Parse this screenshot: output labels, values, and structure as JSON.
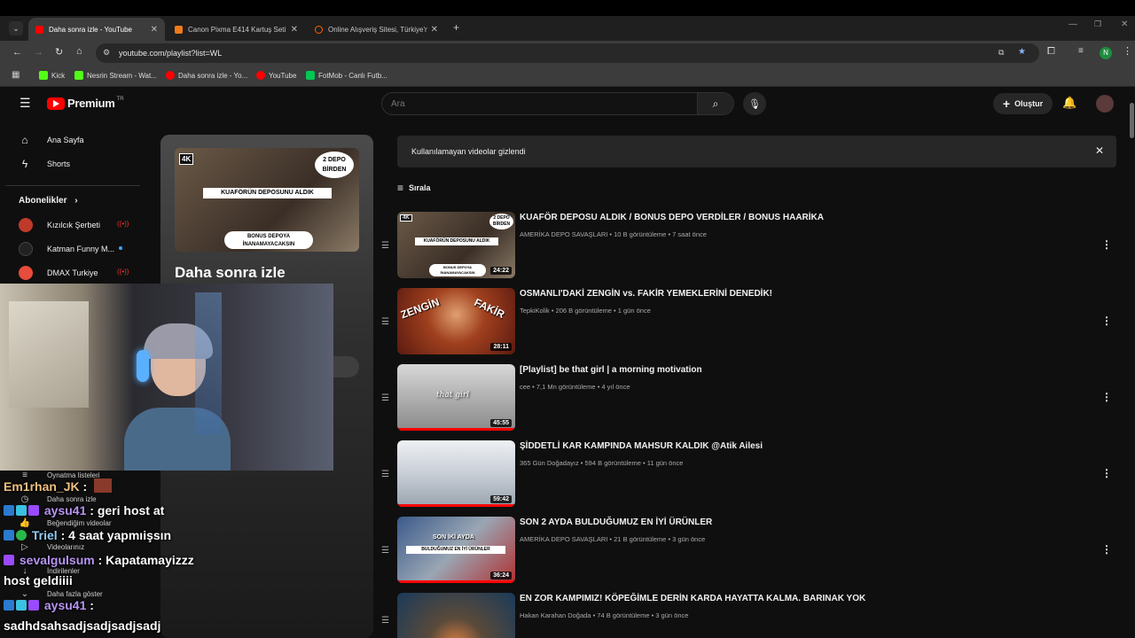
{
  "browser": {
    "tabs": [
      {
        "title": "Daha sonra izle - YouTube",
        "favicon_color": "#ff0000"
      },
      {
        "title": "Canon Pixma E414 Kartuş Seti",
        "favicon_color": "#f27a1a"
      },
      {
        "title": "Online Alışveriş Sitesi, Türkiye'n",
        "favicon_color": "#ff6000"
      }
    ],
    "url": "youtube.com/playlist?list=WL",
    "bookmarks": [
      {
        "label": "Kick",
        "color": "#53fc18"
      },
      {
        "label": "Nesrin Stream - Wat...",
        "color": "#53fc18"
      },
      {
        "label": "Daha sonra izle - Yo...",
        "color": "#ff0000"
      },
      {
        "label": "YouTube",
        "color": "#ff0000"
      },
      {
        "label": "FotMob - Canlı Futb...",
        "color": "#00c853"
      }
    ],
    "profile_initial": "N"
  },
  "youtube": {
    "logo_text": "Premium",
    "region": "TR",
    "search_placeholder": "Ara",
    "create_label": "Oluştur",
    "sidebar": {
      "items": [
        {
          "label": "Ana Sayfa",
          "icon": "home-icon"
        },
        {
          "label": "Shorts",
          "icon": "shorts-icon"
        }
      ],
      "subs_heading": "Abonelikler",
      "subscriptions": [
        {
          "name": "Kızılcık Şerbeti",
          "live": true,
          "color": "#c0392b"
        },
        {
          "name": "Katman Funny M...",
          "live": false,
          "color": "#222222"
        },
        {
          "name": "DMAX Turkiye",
          "live": true,
          "color": "#e74c3c"
        }
      ],
      "you_items": [
        {
          "label": "Oynatma listeleri",
          "icon": "playlist-icon"
        },
        {
          "label": "Daha sonra izle",
          "icon": "clock-icon"
        },
        {
          "label": "Beğendiğim videolar",
          "icon": "like-icon"
        },
        {
          "label": "Videolarınız",
          "icon": "video-icon"
        },
        {
          "label": "İndirilenler",
          "icon": "download-icon"
        },
        {
          "label": "Daha fazla göster",
          "icon": "chevron-down-icon"
        }
      ]
    },
    "playlist": {
      "title": "Daha sonra izle"
    },
    "banner_text": "Kullanılamayan videolar gizlendi",
    "sort_label": "Sırala",
    "videos": [
      {
        "title": "KUAFÖR DEPOSU ALDIK / BONUS DEPO VERDİLER / BONUS HAARİKA",
        "channel": "AMERİKA DEPO SAVAŞLARI",
        "views": "10 B görüntüleme",
        "age": "7 saat önce",
        "duration": "24:22",
        "thumb": "#5a4a3a",
        "progress": 0
      },
      {
        "title": "OSMANLI'DAKİ ZENGİN vs. FAKİR YEMEKLERİNİ DENEDİK!",
        "channel": "TepkiKolik",
        "views": "206 B görüntüleme",
        "age": "1 gün önce",
        "duration": "28:11",
        "thumb": "#8a2a1a",
        "progress": 0
      },
      {
        "title": "[Playlist] be that girl | a morning motivation",
        "channel": "cee",
        "views": "7,1 Mn görüntüleme",
        "age": "4 yıl önce",
        "duration": "45:55",
        "thumb": "#bfbfbf",
        "progress": 1
      },
      {
        "title": "ŞİDDETLİ KAR KAMPINDA MAHSUR KALDIK @Atik Ailesi",
        "channel": "365 Gün Doğadayız",
        "views": "594 B görüntüleme",
        "age": "11 gün önce",
        "duration": "59:42",
        "thumb": "#d8dde2",
        "progress": 1
      },
      {
        "title": "SON 2 AYDA BULDUĞUMUZ EN İYİ ÜRÜNLER",
        "channel": "AMERİKA DEPO SAVAŞLARI",
        "views": "21 B görüntüleme",
        "age": "3 gün önce",
        "duration": "36:24",
        "thumb": "#4a6a9a",
        "progress": 1
      },
      {
        "title": "EN ZOR KAMPIMIZ! KÖPEĞİMLE DERİN KARDA HAYATTA KALMA. BARINAK YOK",
        "channel": "Hakan Karahan Doğada",
        "views": "74 B görüntüleme",
        "age": "3 gün önce",
        "duration": "",
        "thumb": "#2a4a6a",
        "progress": 0
      }
    ]
  },
  "stream_chat": [
    {
      "user": "Em1rhan_JK",
      "message": "",
      "user_color": "#f0c080"
    },
    {
      "user": "aysu41",
      "message": "geri host at",
      "user_color": "#b794f4"
    },
    {
      "user": "Triel",
      "message": "4 saat yapmıişsın",
      "user_color": "#90cdf4"
    },
    {
      "user": "sevalgulsum",
      "message": "Kapatamayizzz",
      "user_color": "#b794f4"
    },
    {
      "user": "",
      "message": "host geldiiii",
      "user_color": "#ffffff"
    },
    {
      "user": "aysu41",
      "message": "",
      "user_color": "#b794f4"
    },
    {
      "user": "",
      "message": "sadhdsahsadjsadjsadjsadj",
      "user_color": "#ffffff"
    }
  ]
}
